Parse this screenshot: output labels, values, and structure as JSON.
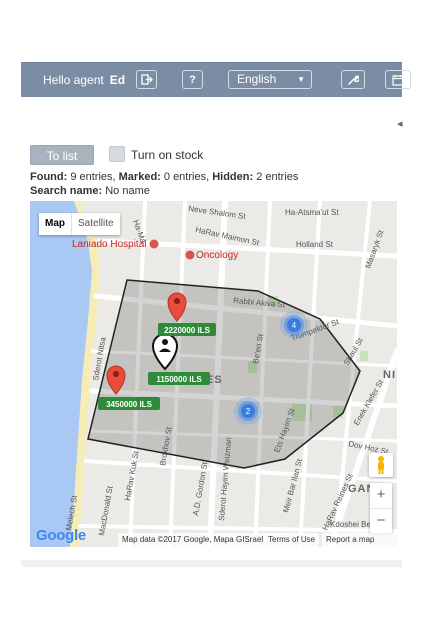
{
  "header": {
    "hello_prefix": "Hello agent",
    "agent_name": "Ed",
    "help_label": "?",
    "language": "English"
  },
  "toolbar": {
    "to_list_label": "To list",
    "turn_on_stock_label": "Turn on stock"
  },
  "summary": {
    "found_label": "Found:",
    "found_value": "9 entries,",
    "marked_label": "Marked:",
    "marked_value": "0 entries,",
    "hidden_label": "Hidden:",
    "hidden_value": "2 entries",
    "search_name_label": "Search name:",
    "search_name_value": "No name"
  },
  "map": {
    "type_map": "Map",
    "type_satellite": "Satellite",
    "zoom_in": "+",
    "zoom_out": "−",
    "google_logo": "Google",
    "attribution": "Map data ©2017 Google, Mapa GISrael",
    "terms": "Terms of Use",
    "report": "Report a map error",
    "labels": {
      "neve_shalom": "Neve Shalom St",
      "ha_atzmaut": "Ha-Atsma'ut St",
      "ha_ma": "Ha-Ma",
      "harav_maimon": "HaRav Maimon St",
      "holland": "Holland St",
      "laniado": "Laniado Hospital",
      "oncology": "Oncology",
      "rabbi_akiva": "Rabbi Akiva St",
      "masaryk": "Masaryk St",
      "sderot_nitsa": "Sderot Nitsa",
      "trumpeldor": "Trumpeldor St",
      "shaul": "Shaul St",
      "ein_hakore": "Ein Hakore",
      "nes": "ES",
      "ni": "NI",
      "be_eri": "Be'eri St",
      "enek_klefer": "Enek Klefer St",
      "dov_hoz": "Dov Hoz St",
      "harav_kuk": "HaRav Kuk St",
      "brokhov": "Brokhov St",
      "sderot_hayim_weizman": "Sderot Hayim Weizman",
      "a_d_gordon": "A.D. Gordon St",
      "meir_bar_ilan": "Meir Bar Ilan St",
      "ets_hayim": "Ets Hayim St",
      "harav_reines": "HaRav Reines St",
      "melech": "Melech St",
      "macdonald": "MacDonald St",
      "gande": "GANDE",
      "kdoshei_bel": "Kdoshei Bel"
    },
    "price_tags": [
      "2220000 ILS",
      "1150000 ILS",
      "3450000 ILS"
    ],
    "clusters": [
      "4",
      "2"
    ]
  }
}
